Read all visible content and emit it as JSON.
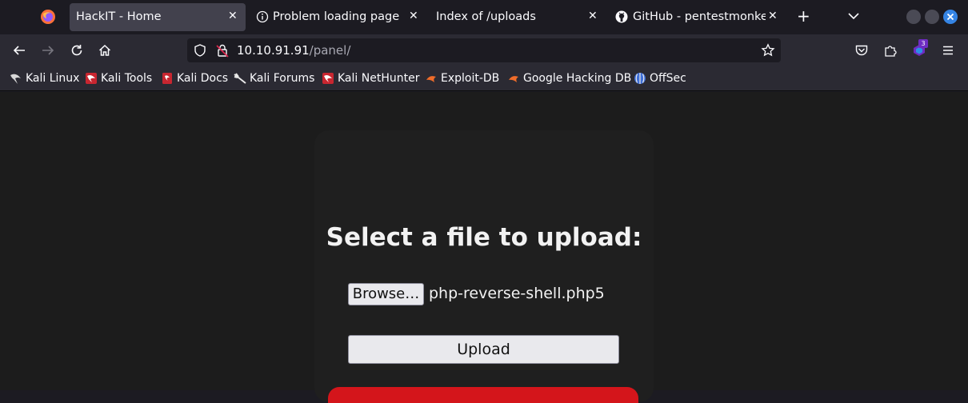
{
  "tabs": [
    {
      "label": "HackIT - Home",
      "active": true
    },
    {
      "label": "Problem loading page",
      "active": false
    },
    {
      "label": "Index of /uploads",
      "active": false
    },
    {
      "label": "GitHub - pentestmonkey/",
      "active": false
    }
  ],
  "urlbar": {
    "host": "10.10.91.91",
    "path": "/panel/"
  },
  "extensions": {
    "badge_count": "3"
  },
  "bookmarks": [
    {
      "label": "Kali Linux",
      "icon": "kali-dragon-icon"
    },
    {
      "label": "Kali Tools",
      "icon": "kali-tools-icon"
    },
    {
      "label": "Kali Docs",
      "icon": "kali-docs-icon"
    },
    {
      "label": "Kali Forums",
      "icon": "kali-forums-icon"
    },
    {
      "label": "Kali NetHunter",
      "icon": "kali-nethunter-icon"
    },
    {
      "label": "Exploit-DB",
      "icon": "exploit-db-icon"
    },
    {
      "label": "Google Hacking DB",
      "icon": "google-hacking-db-icon"
    },
    {
      "label": "OffSec",
      "icon": "offsec-icon"
    }
  ],
  "page": {
    "heading": "Select a file to upload:",
    "browse_label": "Browse…",
    "selected_file": "php-reverse-shell.php5",
    "upload_label": "Upload"
  },
  "colors": {
    "accent_red": "#d4151b",
    "window_close": "#3584e4"
  }
}
